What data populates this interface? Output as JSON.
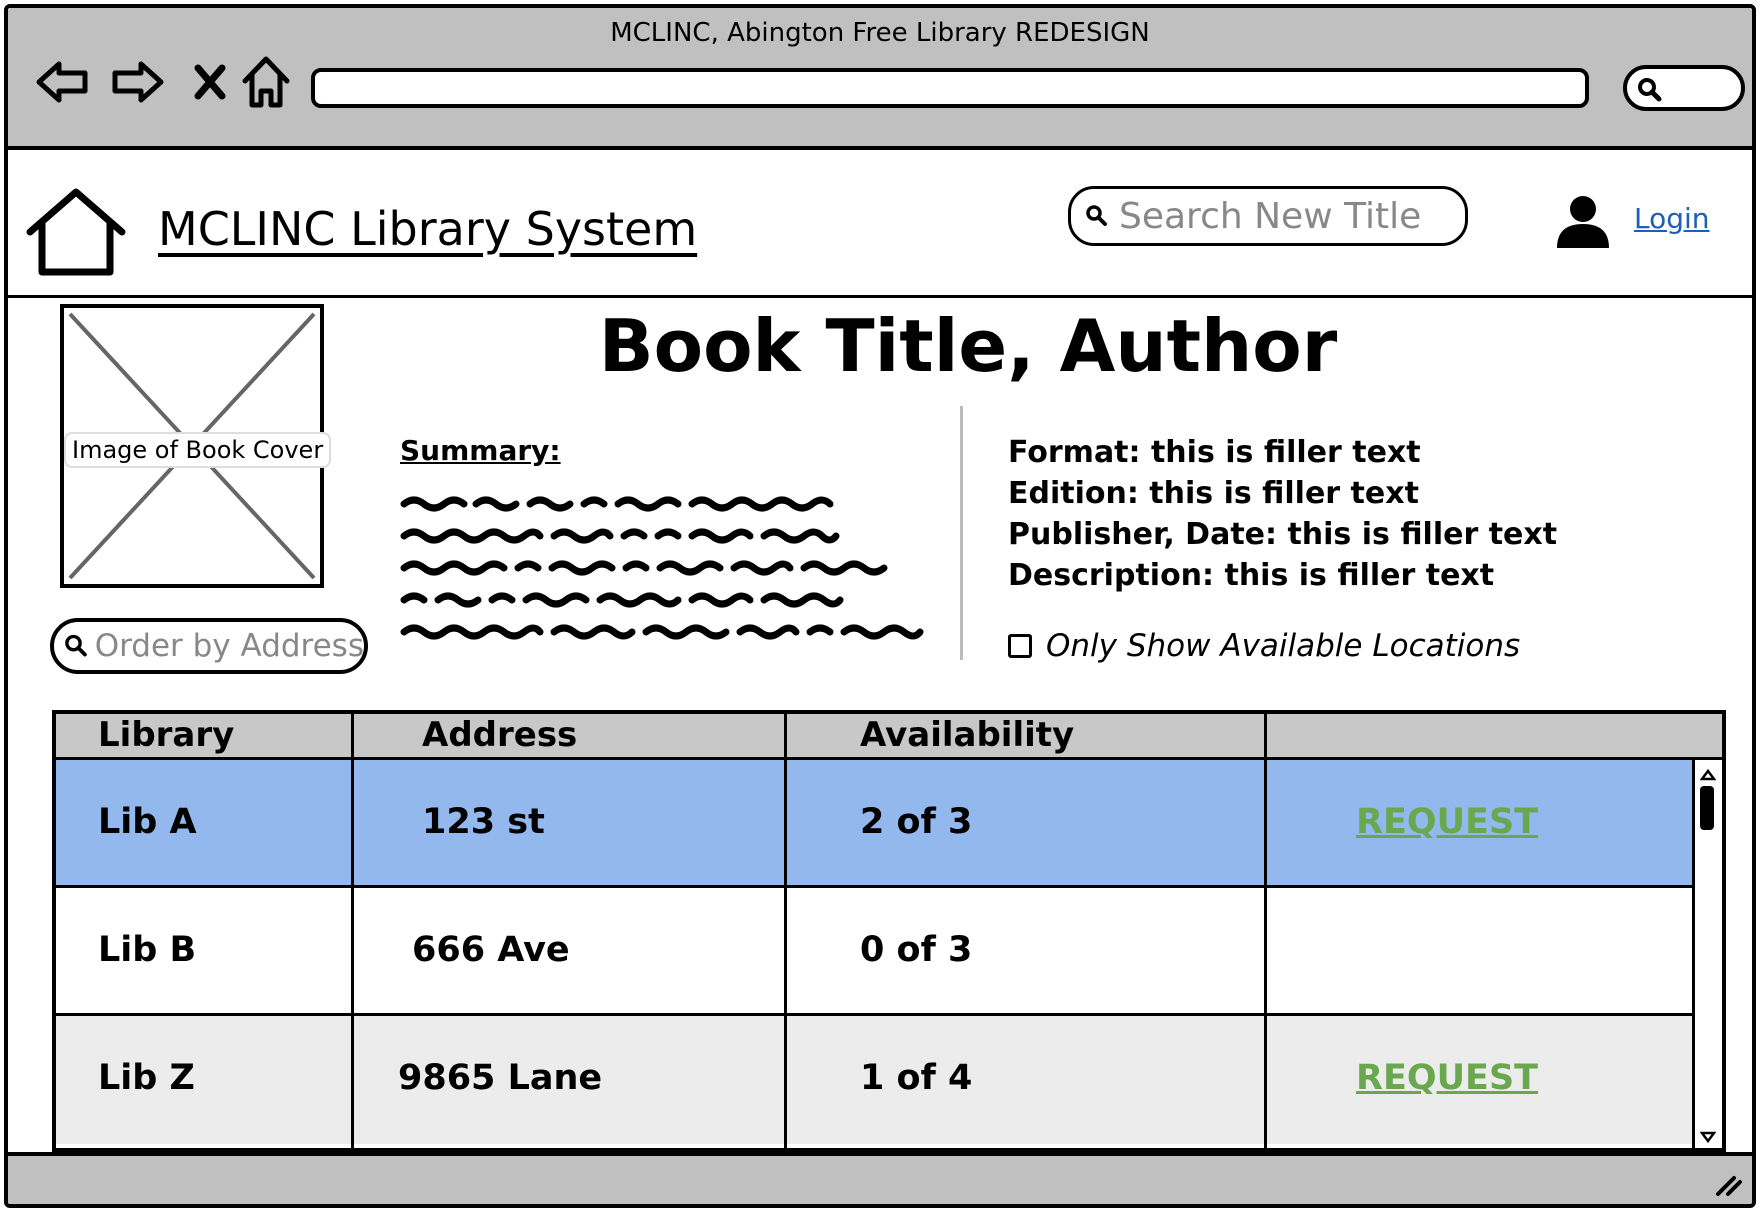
{
  "window": {
    "title": "MCLINC, Abington Free Library REDESIGN"
  },
  "browser": {
    "icons": [
      "back-arrow-icon",
      "forward-arrow-icon",
      "close-x-icon",
      "home-icon",
      "search-icon"
    ]
  },
  "header": {
    "site_title": "MCLINC Library System",
    "search_placeholder": "Search New Title",
    "login_label": "Login"
  },
  "book": {
    "cover_label": "Image of Book Cover",
    "title": "Book Title, Author",
    "summary_label": "Summary:",
    "order_placeholder": "Order by Address",
    "meta": {
      "format": "Format: this is filler text",
      "edition": "Edition: this is filler text",
      "publisher": "Publisher, Date: this is filler text",
      "description": "Description: this is filler text"
    },
    "available_only_label": "Only Show Available Locations",
    "available_only_checked": false
  },
  "table": {
    "columns": [
      "Library",
      "Address",
      "Availability",
      ""
    ],
    "rows": [
      {
        "library": "Lib A",
        "address": "123 st",
        "availability": "2 of 3",
        "action": "REQUEST",
        "selected": true
      },
      {
        "library": "Lib B",
        "address": "666 Ave",
        "availability": "0 of 3",
        "action": ""
      },
      {
        "library": "Lib Z",
        "address": "9865 Lane",
        "availability": "1 of 4",
        "action": "REQUEST"
      }
    ]
  },
  "colors": {
    "chrome": "#c0c0c0",
    "selected_row": "#92b8ee",
    "request_link": "#6aa84f",
    "login_link": "#1b5fb8"
  }
}
